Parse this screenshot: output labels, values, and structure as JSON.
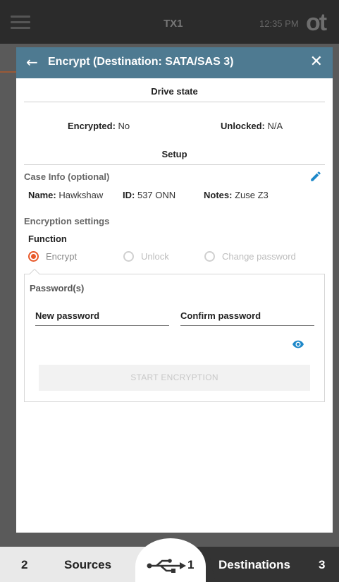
{
  "topbar": {
    "device_name": "TX1",
    "time": "12:35 PM",
    "brand": "ot"
  },
  "modal": {
    "title": "Encrypt (Destination: SATA/SAS 3)",
    "drive_state": {
      "heading": "Drive state",
      "encrypted_label": "Encrypted:",
      "encrypted_value": "No",
      "unlocked_label": "Unlocked:",
      "unlocked_value": "N/A"
    },
    "setup": {
      "heading": "Setup",
      "case_info_label": "Case Info (optional)",
      "name_label": "Name:",
      "name_value": "Hawkshaw",
      "id_label": "ID:",
      "id_value": "537 ONN",
      "notes_label": "Notes:",
      "notes_value": "Zuse Z3",
      "encryption_settings_label": "Encryption settings",
      "function_label": "Function",
      "function_options": [
        "Encrypt",
        "Unlock",
        "Change password"
      ],
      "function_selected": "Encrypt"
    },
    "password": {
      "heading": "Password(s)",
      "new_password_label": "New password",
      "confirm_password_label": "Confirm password"
    },
    "start_button": "START ENCRYPTION"
  },
  "bottombar": {
    "sources_count": "2",
    "sources_label": "Sources",
    "center_count": "1",
    "destinations_label": "Destinations",
    "destinations_count": "3"
  },
  "colors": {
    "header": "#4e7a91",
    "accent": "#e8592a",
    "icon_blue": "#1e88c9"
  }
}
